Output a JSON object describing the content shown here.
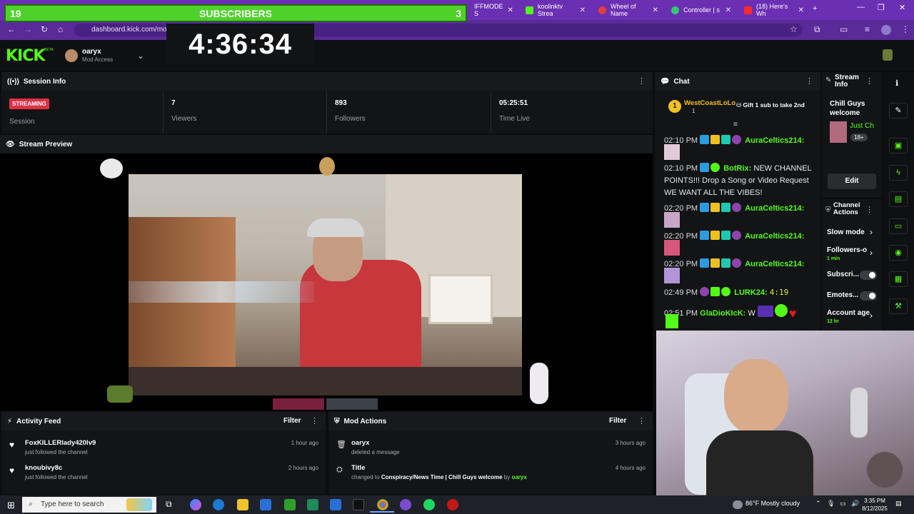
{
  "browser": {
    "tabs": [
      {
        "label": "IFFMODE S",
        "color": "#53fc18"
      },
      {
        "label": "koolinktv Strea",
        "color": "#53fc18"
      },
      {
        "label": "Wheel of Name",
        "color": "#e13d3d"
      },
      {
        "label": "Controller | s",
        "color": "#2ecc71"
      },
      {
        "label": "(18) Here's Wh",
        "color": "#ff2a2a"
      }
    ],
    "url": "dashboard.kick.com/mod"
  },
  "overlay": {
    "sub_left": "19",
    "sub_title": "SUBSCRIBERS",
    "sub_right": "3",
    "timer": "4:36:34"
  },
  "kick": {
    "logo": "KICK",
    "beta": "BETA",
    "username": "oaryx",
    "access": "Mod Access"
  },
  "session": {
    "title": "Session Info",
    "status": "STREAMING",
    "status_label": "Session",
    "viewers_value": "7",
    "viewers_label": "Viewers",
    "followers_value": "893",
    "followers_label": "Followers",
    "time_value": "05:25:51",
    "time_label": "Time Live"
  },
  "preview": {
    "title": "Stream Preview"
  },
  "activity": {
    "title": "Activity Feed",
    "filter": "Filter",
    "items": [
      {
        "user": "FoxKILLERlady420lv9",
        "action": "just followed the channel",
        "ago": "1 hour ago"
      },
      {
        "user": "knoubivy8c",
        "action": "just followed the channel",
        "ago": "2 hours ago"
      }
    ]
  },
  "modactions": {
    "title": "Mod Actions",
    "filter": "Filter",
    "items": [
      {
        "title": "oaryx",
        "desc": "deleted a message",
        "ago": "3 hours ago"
      },
      {
        "title": "Title",
        "desc_prefix": "changed to",
        "desc_bold": "Conspiracy/News Time | Chill Guys welcome",
        "desc_by": "by",
        "desc_user": "oaryx",
        "ago": "4 hours ago"
      }
    ]
  },
  "chat": {
    "title": "Chat",
    "pinned_user": "WestCoastLoLo",
    "pinned_count": "1",
    "pinned_rank": "1",
    "gift_text": "Gift 1 sub to take 2nd",
    "messages": [
      {
        "time": "02:10 PM",
        "user": "AuraCeltics214:",
        "text": "",
        "color": "#53fc18"
      },
      {
        "time": "02:10 PM",
        "user": "BotRix:",
        "text": "NEW CHANNEL POINTS!!! Drop a Song or Video Request WE WANT ALL THE VIBES!",
        "color": "#53fc18"
      },
      {
        "time": "02:20 PM",
        "user": "AuraCeltics214:",
        "text": "",
        "color": "#53fc18"
      },
      {
        "time": "02:20 PM",
        "user": "AuraCeltics214:",
        "text": "",
        "color": "#53fc18"
      },
      {
        "time": "02:20 PM",
        "user": "AuraCeltics214:",
        "text": "",
        "color": "#53fc18"
      },
      {
        "time": "02:49 PM",
        "user": "LURK24:",
        "text": "4:19",
        "color": "#53fc18"
      },
      {
        "time": "02:51 PM",
        "user": "GlaDioKIcK:",
        "text": "W",
        "color": "#53fc18"
      }
    ]
  },
  "streaminfo": {
    "title": "Stream Info",
    "stream_title": "Chill Guys welcome",
    "category": "Just Ch",
    "rating": "18+",
    "edit": "Edit"
  },
  "channel_actions": {
    "title": "Channel Actions",
    "slow_mode": "Slow mode",
    "followers": "Followers-o",
    "followers_sub": "1 min",
    "subscribers": "Subscri...",
    "emotes": "Emotes...",
    "account_age": "Account age",
    "account_age_sub": "12 hr"
  },
  "taskbar": {
    "search": "Type here to search",
    "weather": "86°F  Mostly cloudy",
    "time": "3:35 PM",
    "date": "8/12/2025"
  }
}
